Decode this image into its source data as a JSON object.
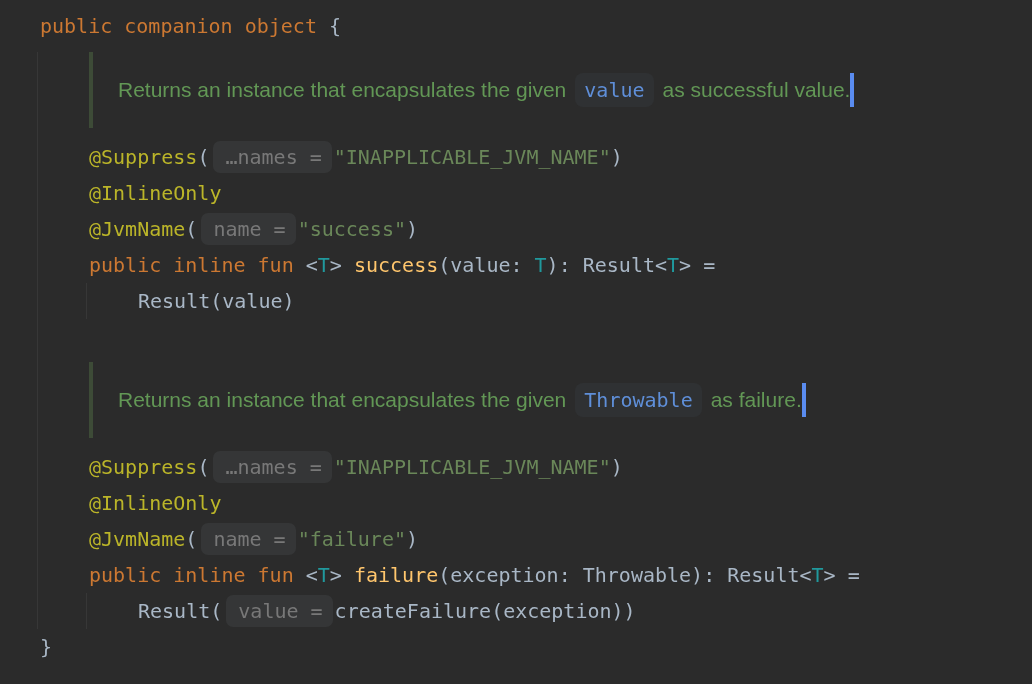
{
  "editor": {
    "blocks": [
      {
        "kind": "code",
        "tokens": [
          {
            "kind": "keyword",
            "text": "public companion object"
          },
          {
            "kind": "plain",
            "text": " {"
          }
        ]
      },
      {
        "kind": "block",
        "children": [
          {
            "kind": "doc",
            "caret": true,
            "parts": [
              {
                "kind": "text",
                "text": "Returns an instance that encapsulates the given"
              },
              {
                "kind": "code",
                "text": "value"
              },
              {
                "kind": "text",
                "text": "as successful value."
              }
            ]
          },
          {
            "kind": "code",
            "tokens": [
              {
                "kind": "annotation",
                "text": "@Suppress"
              },
              {
                "kind": "plain",
                "text": "("
              },
              {
                "kind": "hint",
                "text": "…names ="
              },
              {
                "kind": "string",
                "text": "\"INAPPLICABLE_JVM_NAME\""
              },
              {
                "kind": "plain",
                "text": ")"
              }
            ]
          },
          {
            "kind": "code",
            "tokens": [
              {
                "kind": "annotation",
                "text": "@InlineOnly"
              }
            ]
          },
          {
            "kind": "code",
            "tokens": [
              {
                "kind": "annotation",
                "text": "@JvmName"
              },
              {
                "kind": "plain",
                "text": "("
              },
              {
                "kind": "hint",
                "text": "name ="
              },
              {
                "kind": "string",
                "text": "\"success\""
              },
              {
                "kind": "plain",
                "text": ")"
              }
            ]
          },
          {
            "kind": "code",
            "tokens": [
              {
                "kind": "keyword",
                "text": "public inline fun"
              },
              {
                "kind": "plain",
                "text": " <"
              },
              {
                "kind": "type",
                "text": "T"
              },
              {
                "kind": "plain",
                "text": "> "
              },
              {
                "kind": "function",
                "text": "success"
              },
              {
                "kind": "plain",
                "text": "(value: "
              },
              {
                "kind": "type",
                "text": "T"
              },
              {
                "kind": "plain",
                "text": "): Result<"
              },
              {
                "kind": "type",
                "text": "T"
              },
              {
                "kind": "plain",
                "text": "> ="
              }
            ]
          },
          {
            "kind": "block",
            "children": [
              {
                "kind": "code",
                "tokens": [
                  {
                    "kind": "plain",
                    "text": "Result(value)"
                  }
                ]
              }
            ]
          },
          {
            "kind": "blank"
          },
          {
            "kind": "doc",
            "caret": true,
            "parts": [
              {
                "kind": "text",
                "text": "Returns an instance that encapsulates the given"
              },
              {
                "kind": "code",
                "text": "Throwable"
              },
              {
                "kind": "text",
                "text": "as failure."
              }
            ]
          },
          {
            "kind": "code",
            "tokens": [
              {
                "kind": "annotation",
                "text": "@Suppress"
              },
              {
                "kind": "plain",
                "text": "("
              },
              {
                "kind": "hint",
                "text": "…names ="
              },
              {
                "kind": "string",
                "text": "\"INAPPLICABLE_JVM_NAME\""
              },
              {
                "kind": "plain",
                "text": ")"
              }
            ]
          },
          {
            "kind": "code",
            "tokens": [
              {
                "kind": "annotation",
                "text": "@InlineOnly"
              }
            ]
          },
          {
            "kind": "code",
            "tokens": [
              {
                "kind": "annotation",
                "text": "@JvmName"
              },
              {
                "kind": "plain",
                "text": "("
              },
              {
                "kind": "hint",
                "text": "name ="
              },
              {
                "kind": "string",
                "text": "\"failure\""
              },
              {
                "kind": "plain",
                "text": ")"
              }
            ]
          },
          {
            "kind": "code",
            "tokens": [
              {
                "kind": "keyword",
                "text": "public inline fun"
              },
              {
                "kind": "plain",
                "text": " <"
              },
              {
                "kind": "type",
                "text": "T"
              },
              {
                "kind": "plain",
                "text": "> "
              },
              {
                "kind": "function",
                "text": "failure"
              },
              {
                "kind": "plain",
                "text": "(exception: Throwable): Result<"
              },
              {
                "kind": "type",
                "text": "T"
              },
              {
                "kind": "plain",
                "text": "> ="
              }
            ]
          },
          {
            "kind": "block",
            "children": [
              {
                "kind": "code",
                "tokens": [
                  {
                    "kind": "plain",
                    "text": "Result("
                  },
                  {
                    "kind": "hint",
                    "text": "value ="
                  },
                  {
                    "kind": "plain",
                    "text": "createFailure(exception))"
                  }
                ]
              }
            ]
          }
        ]
      },
      {
        "kind": "code",
        "tokens": [
          {
            "kind": "plain",
            "text": "}"
          }
        ]
      }
    ]
  }
}
